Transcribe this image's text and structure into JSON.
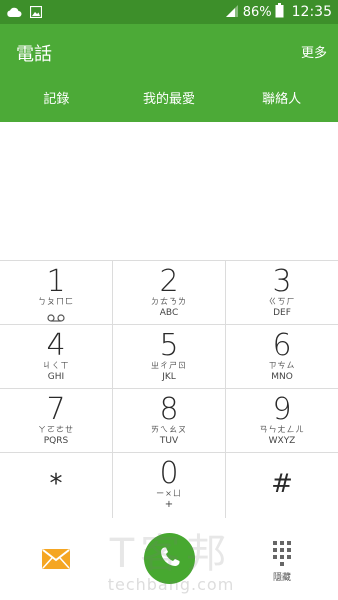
{
  "status_bar": {
    "battery_percent": "86%",
    "time": "12:35",
    "icons": [
      "cloud-icon",
      "image-icon",
      "signal-icon",
      "battery-icon"
    ]
  },
  "app_bar": {
    "title": "電話",
    "more_label": "更多",
    "tabs": [
      {
        "label": "記錄"
      },
      {
        "label": "我的最愛"
      },
      {
        "label": "聯絡人"
      }
    ]
  },
  "keypad": {
    "keys": [
      {
        "digit": "1",
        "zhuyin": "ㄅㄆㄇㄈ",
        "letters": ""
      },
      {
        "digit": "2",
        "zhuyin": "ㄉㄊㄋㄌ",
        "letters": "ABC"
      },
      {
        "digit": "3",
        "zhuyin": "ㄍㄎㄏ",
        "letters": "DEF"
      },
      {
        "digit": "4",
        "zhuyin": "ㄐㄑㄒ",
        "letters": "GHI"
      },
      {
        "digit": "5",
        "zhuyin": "ㄓㄔㄕㄖ",
        "letters": "JKL"
      },
      {
        "digit": "6",
        "zhuyin": "ㄗㄘㄙ",
        "letters": "MNO"
      },
      {
        "digit": "7",
        "zhuyin": "ㄚㄛㄜㄝ",
        "letters": "PQRS"
      },
      {
        "digit": "8",
        "zhuyin": "ㄞㄟㄠㄡ",
        "letters": "TUV"
      },
      {
        "digit": "9",
        "zhuyin": "ㄢㄣㄤㄥㄦ",
        "letters": "WXYZ"
      },
      {
        "digit": "*"
      },
      {
        "digit": "0",
        "zhuyin": "ー×ㄩ",
        "letters": "+"
      },
      {
        "digit": "#"
      }
    ]
  },
  "bottom_bar": {
    "hide_label": "隱藏"
  },
  "watermark": {
    "text": "T客邦",
    "url": "techbang.com"
  },
  "colors": {
    "status_bar": "#3d8f2a",
    "app_bar": "#4caa37",
    "call_button": "#47a830",
    "message_icon": "#f5a623"
  }
}
